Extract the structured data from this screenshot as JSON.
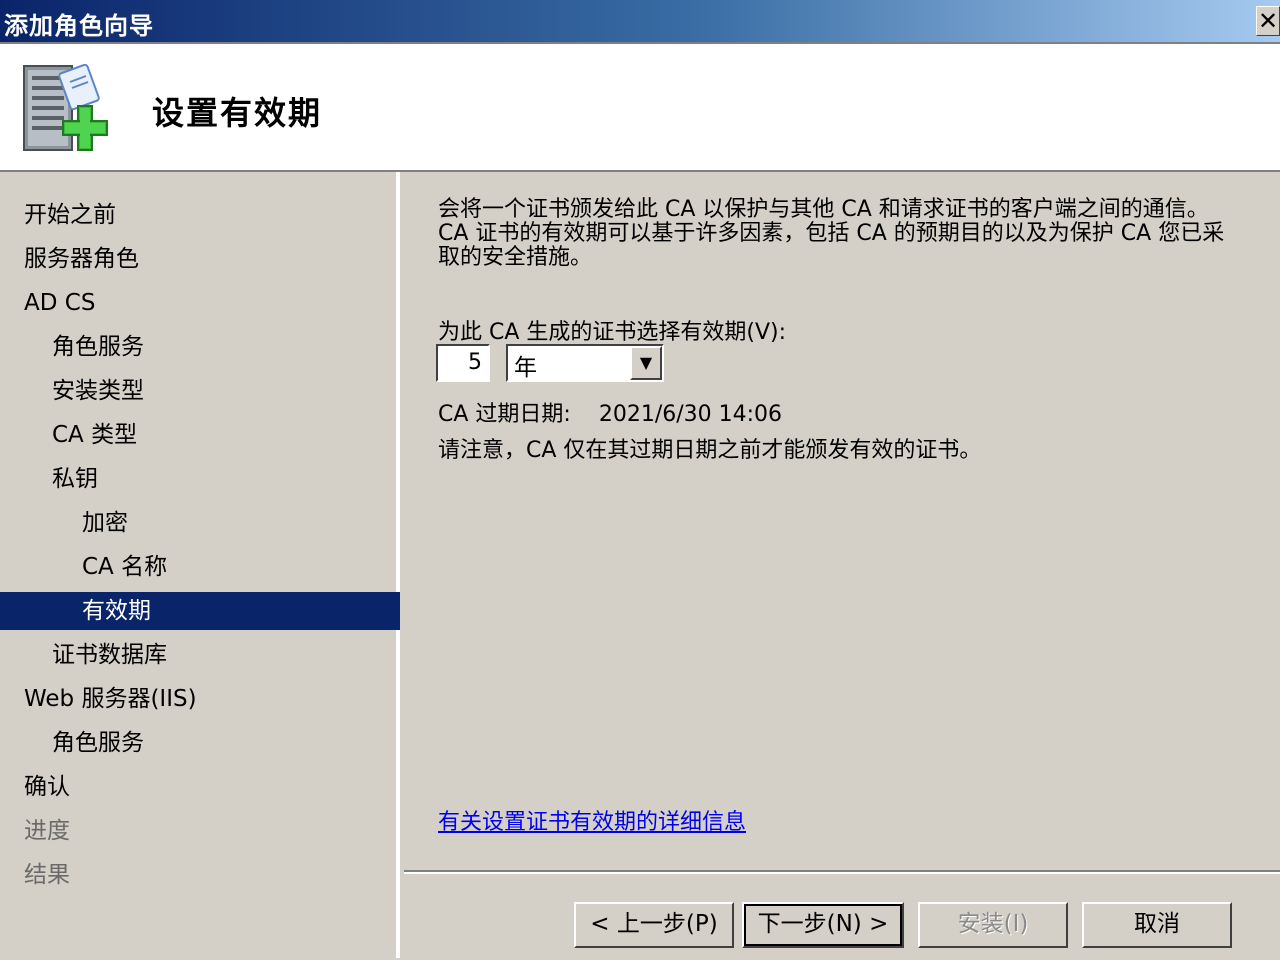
{
  "window": {
    "title": "添加角色向导",
    "close_label": "✕"
  },
  "header": {
    "page_title": "设置有效期",
    "icon": "server-add-role-icon"
  },
  "nav": {
    "items": [
      {
        "label": "开始之前",
        "level": 0,
        "state": "normal"
      },
      {
        "label": "服务器角色",
        "level": 0,
        "state": "normal"
      },
      {
        "label": "AD CS",
        "level": 0,
        "state": "normal"
      },
      {
        "label": "角色服务",
        "level": 1,
        "state": "normal"
      },
      {
        "label": "安装类型",
        "level": 1,
        "state": "normal"
      },
      {
        "label": "CA 类型",
        "level": 1,
        "state": "normal"
      },
      {
        "label": "私钥",
        "level": 1,
        "state": "normal"
      },
      {
        "label": "加密",
        "level": 2,
        "state": "normal"
      },
      {
        "label": "CA 名称",
        "level": 2,
        "state": "normal"
      },
      {
        "label": "有效期",
        "level": 2,
        "state": "selected"
      },
      {
        "label": "证书数据库",
        "level": 1,
        "state": "normal"
      },
      {
        "label": "Web 服务器(IIS)",
        "level": 0,
        "state": "normal"
      },
      {
        "label": "角色服务",
        "level": 1,
        "state": "normal"
      },
      {
        "label": "确认",
        "level": 0,
        "state": "normal"
      },
      {
        "label": "进度",
        "level": 0,
        "state": "disabled"
      },
      {
        "label": "结果",
        "level": 0,
        "state": "disabled"
      }
    ]
  },
  "content": {
    "description": "会将一个证书颁发给此 CA 以保护与其他 CA 和请求证书的客户端之间的通信。CA 证书的有效期可以基于许多因素，包括 CA 的预期目的以及为保护 CA 您已采取的安全措施。",
    "period_label": "为此 CA 生成的证书选择有效期(V):",
    "period_value": "5",
    "period_unit": "年",
    "expiry_label": "CA 过期日期:",
    "expiry_value": "2021/6/30 14:06",
    "note": "请注意，CA 仅在其过期日期之前才能颁发有效的证书。",
    "link": "有关设置证书有效期的详细信息"
  },
  "buttons": {
    "back": "< 上一步(P)",
    "next": "下一步(N) >",
    "install": "安装(I)",
    "cancel": "取消"
  }
}
